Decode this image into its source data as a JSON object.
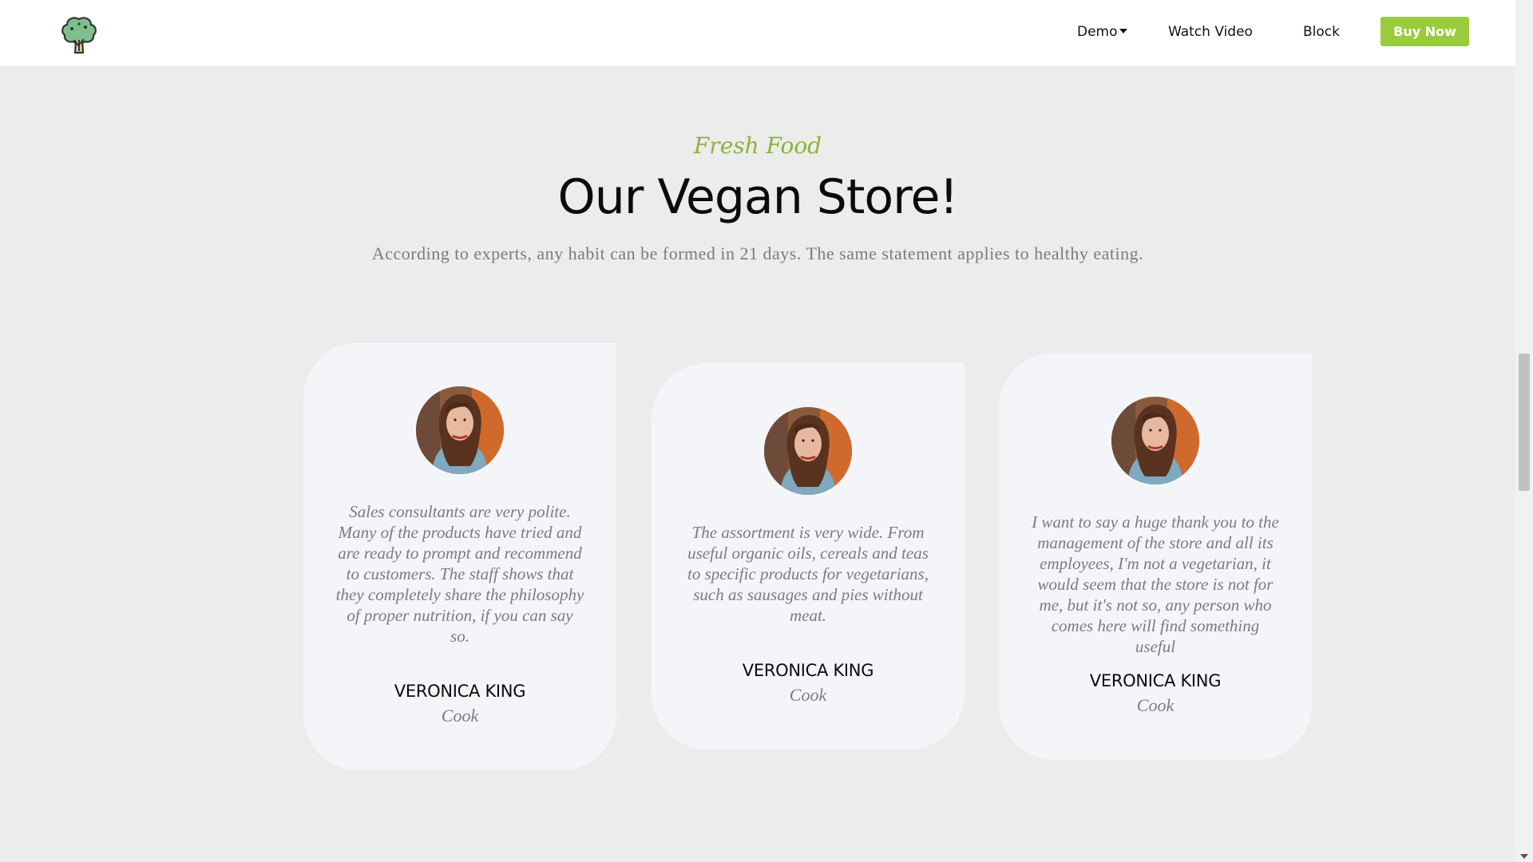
{
  "header": {
    "logo_icon": "broccoli-tree-icon",
    "nav": {
      "demo": "Demo",
      "watch_video": "Watch Video",
      "block": "Block"
    },
    "buy_now": "Buy Now"
  },
  "intro": {
    "eyebrow": "Fresh Food",
    "title": "Our Vegan Store!",
    "subtitle": "According to experts, any habit can be formed in 21 days. The same statement applies to healthy eating."
  },
  "testimonials": [
    {
      "quote": "Sales consultants are very polite. Many of the products have tried and are ready to prompt and recommend to customers. The staff shows that they completely share the philosophy of proper nutrition, if you can say so.",
      "name": "VERONICA KING",
      "role": "Cook"
    },
    {
      "quote": "The assortment is very wide. From useful organic oils, cereals and teas to specific products for vegetarians, such as sausages and pies without meat.",
      "name": "VERONICA KING",
      "role": "Cook"
    },
    {
      "quote": "I want to say a huge thank you to the management of the store and all its employees, I'm not a vegetarian, it would seem that the store is not for me, but it's not so, any person who comes here will find something useful",
      "name": "VERONICA KING",
      "role": "Cook"
    }
  ],
  "colors": {
    "accent": "#9acb3c",
    "eyebrow": "#8ab43a",
    "page_bg": "#ececec",
    "card_bg": "#f4f5f9"
  }
}
